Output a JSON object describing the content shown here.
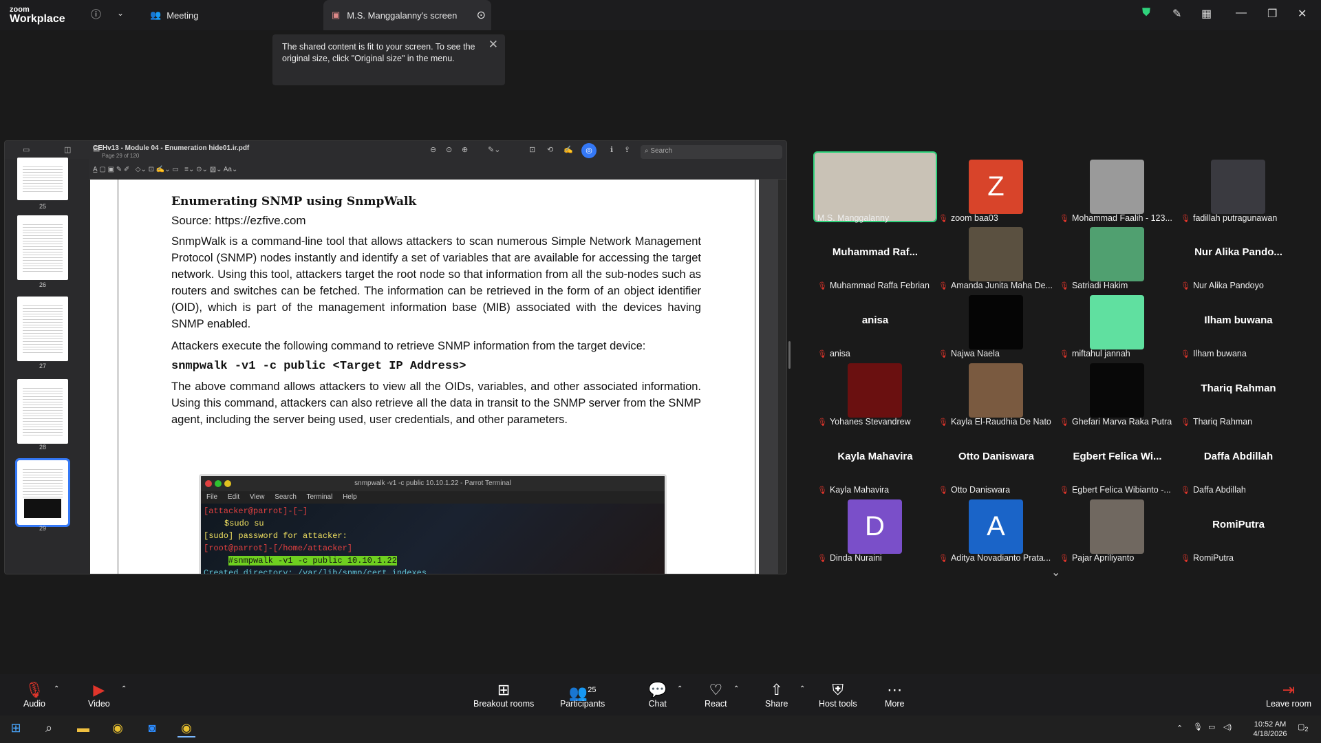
{
  "app": {
    "logo_line1": "zoom",
    "logo_line2": "Workplace",
    "meeting_label": "Meeting",
    "screen_tab": "M.S. Manggalanny's screen"
  },
  "toast": {
    "text": "The shared content is fit to your screen. To see the original size, click \"Original size\" in the menu."
  },
  "pdf": {
    "title": "CEHv13 - Module 04 - Enumeration hide01.ir.pdf",
    "subtitle": "Page 29 of 120",
    "search_placeholder": "Search",
    "thumbs": [
      "25",
      "26",
      "27",
      "28",
      "29"
    ],
    "heading": "Enumerating SNMP using SnmpWalk",
    "source": "Source: https://ezfive.com",
    "para1": "SnmpWalk is a command-line tool that allows attackers to scan numerous Simple Network Management Protocol (SNMP) nodes instantly and identify a set of variables that are available for accessing the target network. Using this tool, attackers target the root node so that information from all the sub-nodes such as routers and switches can be fetched. The information can be retrieved in the form of an object identifier (OID), which is part of the management information base (MIB) associated with the devices having SNMP enabled.",
    "para2": "Attackers execute the following command to retrieve SNMP information from the target device:",
    "command": "snmpwalk -v1 -c public <Target IP Address>",
    "para3": "The above command allows attackers to view all the OIDs, variables, and other associated information. Using this command, attackers can also retrieve all the data in transit to the SNMP server from the SNMP agent, including the server being used, user credentials, and other parameters.",
    "terminal": {
      "title": "snmpwalk -v1 -c public 10.10.1.22 - Parrot Terminal",
      "menu": [
        "File",
        "Edit",
        "View",
        "Search",
        "Terminal",
        "Help"
      ],
      "l1a": "[attacker@parrot]-[~]",
      "l2": "$sudo su",
      "l3": "[sudo] password for attacker:",
      "l4a": "[root@parrot]-[/home/attacker]",
      "l5": "#snmpwalk -v1 -c public 10.10.1.22",
      "l6": "Created directory: /var/lib/snmp/cert_indexes"
    }
  },
  "participants": [
    {
      "name": "M.S. Manggalanny",
      "type": "video",
      "muted": false,
      "color": "#c9c2b6"
    },
    {
      "name": "zoom baa03",
      "type": "letter",
      "letter": "Z",
      "color": "#d8442a",
      "muted": true
    },
    {
      "name": "Mohammad Faalih - 123...",
      "type": "video",
      "color": "#9a9a9a",
      "muted": true
    },
    {
      "name": "fadillah putragunawan",
      "type": "video",
      "color": "#3a3a40",
      "muted": true
    },
    {
      "name": "Muhammad Raffa Febrian",
      "type": "name",
      "big": "Muhammad Raf...",
      "muted": true
    },
    {
      "name": "Amanda Junita Maha De...",
      "type": "video",
      "color": "#5a5040",
      "muted": true
    },
    {
      "name": "Satriadi Hakim",
      "type": "video",
      "color": "#50a070",
      "muted": true
    },
    {
      "name": "Nur Alika Pandoyo",
      "type": "name",
      "big": "Nur Alika Pando...",
      "muted": true
    },
    {
      "name": "anisa",
      "type": "name",
      "big": "anisa",
      "muted": true
    },
    {
      "name": "Najwa Naela",
      "type": "video",
      "color": "#050505",
      "muted": true
    },
    {
      "name": "miftahul jannah",
      "type": "video",
      "color": "#60e0a0",
      "muted": true
    },
    {
      "name": "Ilham buwana",
      "type": "name",
      "big": "Ilham buwana",
      "muted": true
    },
    {
      "name": "Yohanes Stevandrew",
      "type": "video",
      "color": "#6a1010",
      "muted": true
    },
    {
      "name": "Kayla El-Raudhia De Nato",
      "type": "video",
      "color": "#7a5a40",
      "muted": true
    },
    {
      "name": "Ghefari Marva Raka Putra",
      "type": "video",
      "color": "#080808",
      "muted": true
    },
    {
      "name": "Thariq Rahman",
      "type": "name",
      "big": "Thariq Rahman",
      "muted": true
    },
    {
      "name": "Kayla Mahavira",
      "type": "name",
      "big": "Kayla Mahavira",
      "muted": true
    },
    {
      "name": "Otto Daniswara",
      "type": "name",
      "big": "Otto Daniswara",
      "muted": true
    },
    {
      "name": "Egbert Felica Wibianto -...",
      "type": "name",
      "big": "Egbert Felica Wi...",
      "muted": true
    },
    {
      "name": "Daffa Abdillah",
      "type": "name",
      "big": "Daffa Abdillah",
      "muted": true
    },
    {
      "name": "Dinda Nuraini",
      "type": "letter",
      "letter": "D",
      "color": "#7a4fc9",
      "muted": true
    },
    {
      "name": "Aditya Novadianto Prata...",
      "type": "letter",
      "letter": "A",
      "color": "#1a64c8",
      "muted": true
    },
    {
      "name": "Pajar Apriliyanto",
      "type": "video",
      "color": "#706860",
      "muted": true
    },
    {
      "name": "RomiPutra",
      "type": "name",
      "big": "RomiPutra",
      "muted": true
    }
  ],
  "toolbar": {
    "audio": "Audio",
    "video": "Video",
    "breakout": "Breakout rooms",
    "participants": "Participants",
    "participants_count": "25",
    "chat": "Chat",
    "react": "React",
    "share": "Share",
    "host_tools": "Host tools",
    "more": "More",
    "leave": "Leave room"
  },
  "taskbar": {
    "time": "10:52 AM",
    "date": "4/18/2026",
    "notif_count": "2"
  },
  "colors": {
    "accent": "#3478f6",
    "active_speaker": "#2fd37c",
    "muted": "#e0352b"
  }
}
